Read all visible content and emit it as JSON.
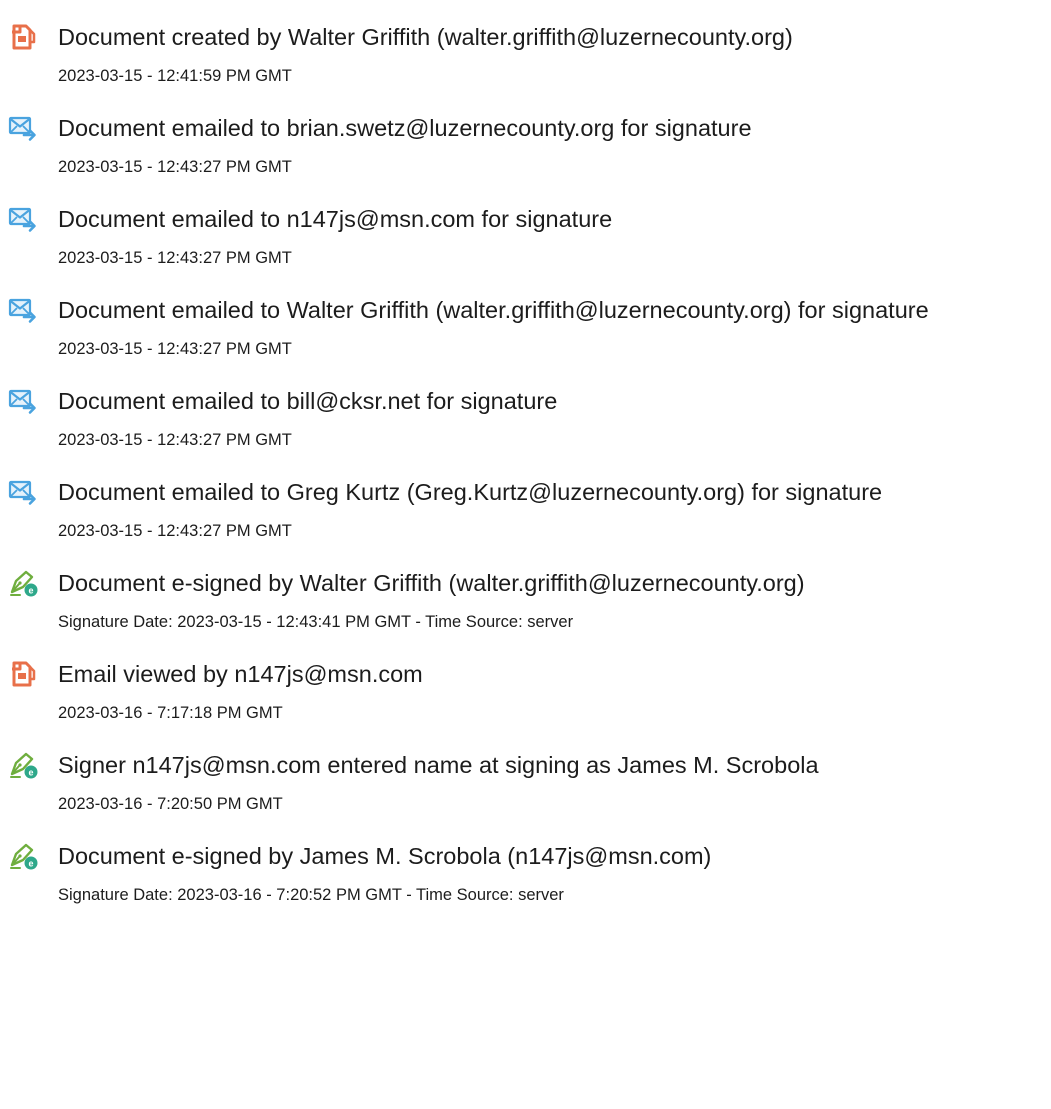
{
  "colors": {
    "document_icon": "#e8704a",
    "email_icon": "#4aa3df",
    "sign_icon_pen": "#6fae3e",
    "sign_icon_badge": "#2ea88a"
  },
  "events": [
    {
      "icon": "document-icon",
      "title": "Document created by Walter Griffith (walter.griffith@luzernecounty.org)",
      "detail": "2023-03-15 - 12:41:59 PM GMT"
    },
    {
      "icon": "email-forward-icon",
      "title": "Document emailed to brian.swetz@luzernecounty.org for signature",
      "detail": "2023-03-15 - 12:43:27 PM GMT"
    },
    {
      "icon": "email-forward-icon",
      "title": "Document emailed to n147js@msn.com for signature",
      "detail": "2023-03-15 - 12:43:27 PM GMT"
    },
    {
      "icon": "email-forward-icon",
      "title": "Document emailed to Walter Griffith (walter.griffith@luzernecounty.org) for signature",
      "detail": "2023-03-15 - 12:43:27 PM GMT"
    },
    {
      "icon": "email-forward-icon",
      "title": "Document emailed to bill@cksr.net for signature",
      "detail": "2023-03-15 - 12:43:27 PM GMT"
    },
    {
      "icon": "email-forward-icon",
      "title": "Document emailed to Greg Kurtz (Greg.Kurtz@luzernecounty.org) for signature",
      "detail": "2023-03-15 - 12:43:27 PM GMT"
    },
    {
      "icon": "esign-pen-icon",
      "title": "Document e-signed by Walter Griffith (walter.griffith@luzernecounty.org)",
      "detail": "Signature Date: 2023-03-15 - 12:43:41 PM GMT - Time Source: server"
    },
    {
      "icon": "document-icon",
      "title": "Email viewed by n147js@msn.com",
      "detail": "2023-03-16 - 7:17:18 PM GMT"
    },
    {
      "icon": "esign-pen-icon",
      "title": "Signer n147js@msn.com entered name at signing as James M. Scrobola",
      "detail": "2023-03-16 - 7:20:50 PM GMT"
    },
    {
      "icon": "esign-pen-icon",
      "title": "Document e-signed by James M. Scrobola (n147js@msn.com)",
      "detail": "Signature Date: 2023-03-16 - 7:20:52 PM GMT - Time Source: server"
    }
  ]
}
